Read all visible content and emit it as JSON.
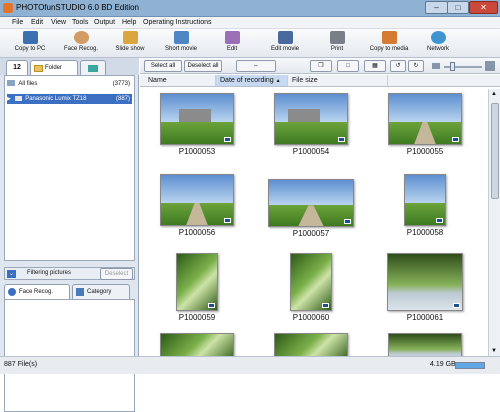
{
  "window": {
    "title": "PHOTOfunSTUDIO 6.0 BD Edition",
    "min": "–",
    "max": "□",
    "close": "✕"
  },
  "menu": [
    "File",
    "Edit",
    "View",
    "Tools",
    "Output",
    "Help",
    "Operating Instructions"
  ],
  "toolbar": [
    {
      "label": "Copy to PC",
      "icon": "copy-to-pc-icon"
    },
    {
      "label": "Face Recog.",
      "icon": "face-recog-icon"
    },
    {
      "label": "Slide show",
      "icon": "slide-show-icon"
    },
    {
      "label": "Short movie",
      "icon": "short-movie-icon"
    },
    {
      "label": "Edit",
      "icon": "edit-icon"
    },
    {
      "label": "Edit movie",
      "icon": "edit-movie-icon"
    },
    {
      "label": "Print",
      "icon": "print-icon"
    },
    {
      "label": "Copy to media",
      "icon": "copy-to-media-icon"
    },
    {
      "label": "Network",
      "icon": "network-icon"
    }
  ],
  "left": {
    "calendar_tab": "12",
    "folder_tab": "Folder",
    "tree": {
      "all_files": "All files",
      "all_count": "(3773)",
      "device": "Panasonic Lumix TZ18",
      "device_count": "(887)"
    },
    "filtering_label": "Filtering pictures",
    "deselect_label": "Deselect",
    "face_tab": "Face Recog.",
    "category_tab": "Category"
  },
  "subtoolbar": {
    "select_all": "Select all",
    "deselect_all": "Deselect all"
  },
  "columns": {
    "name": "Name",
    "date": "Date of recording",
    "sort_arrow": "▲",
    "size": "File size"
  },
  "thumbnails": [
    {
      "label": "P1000053",
      "scene": "building"
    },
    {
      "label": "P1000054",
      "scene": "building"
    },
    {
      "label": "P1000055",
      "scene": "path"
    },
    {
      "label": "P1000056",
      "scene": "path"
    },
    {
      "label": "P1000057",
      "scene": "path"
    },
    {
      "label": "P1000058",
      "scene": "field"
    },
    {
      "label": "P1000059",
      "scene": "trees"
    },
    {
      "label": "P1000060",
      "scene": "trees"
    },
    {
      "label": "P1000061",
      "scene": "goose"
    }
  ],
  "status": {
    "files": "887 File(s)",
    "disk": "4.19 GB"
  }
}
